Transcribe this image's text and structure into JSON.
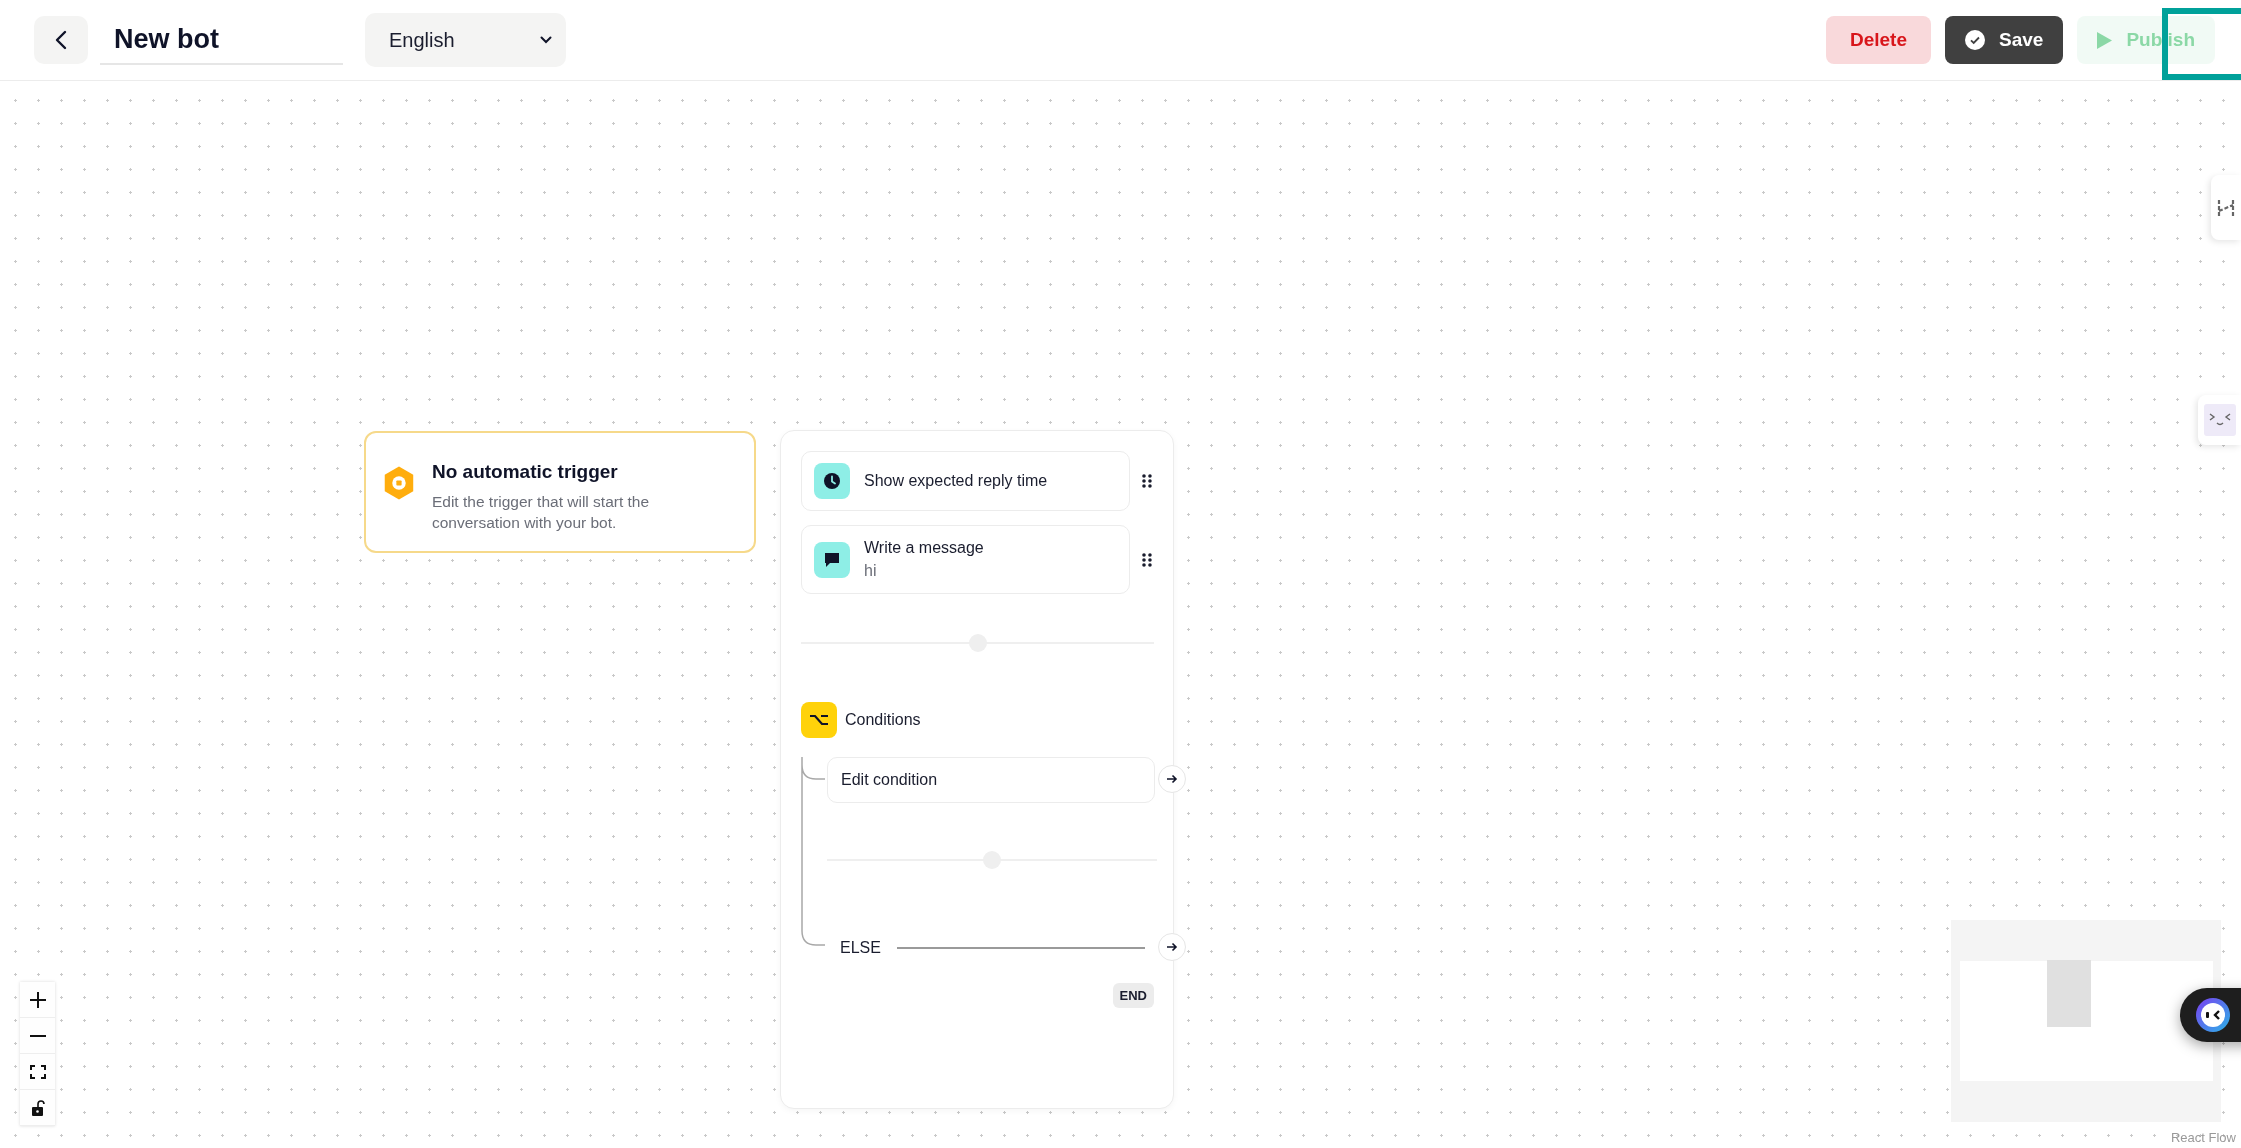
{
  "header": {
    "title": "New bot",
    "language": "English",
    "buttons": [
      {
        "kind": "delete",
        "label": "Delete",
        "disabled": false
      },
      {
        "kind": "save",
        "label": "Save",
        "disabled": false
      },
      {
        "kind": "publish",
        "label": "Publish",
        "disabled": true
      }
    ]
  },
  "trigger": {
    "title": "No automatic trigger",
    "description": "Edit the trigger that will start the conversation with your bot."
  },
  "steps": [
    {
      "kind": "reply-time",
      "label": "Show expected reply time"
    },
    {
      "kind": "message",
      "label": "Write a message",
      "text": "hi"
    }
  ],
  "conditions": {
    "title": "Conditions",
    "branches": [
      {
        "kind": "condition",
        "label": "Edit condition"
      },
      {
        "kind": "else",
        "label": "ELSE"
      }
    ],
    "end": "END"
  },
  "attribution": "React Flow"
}
